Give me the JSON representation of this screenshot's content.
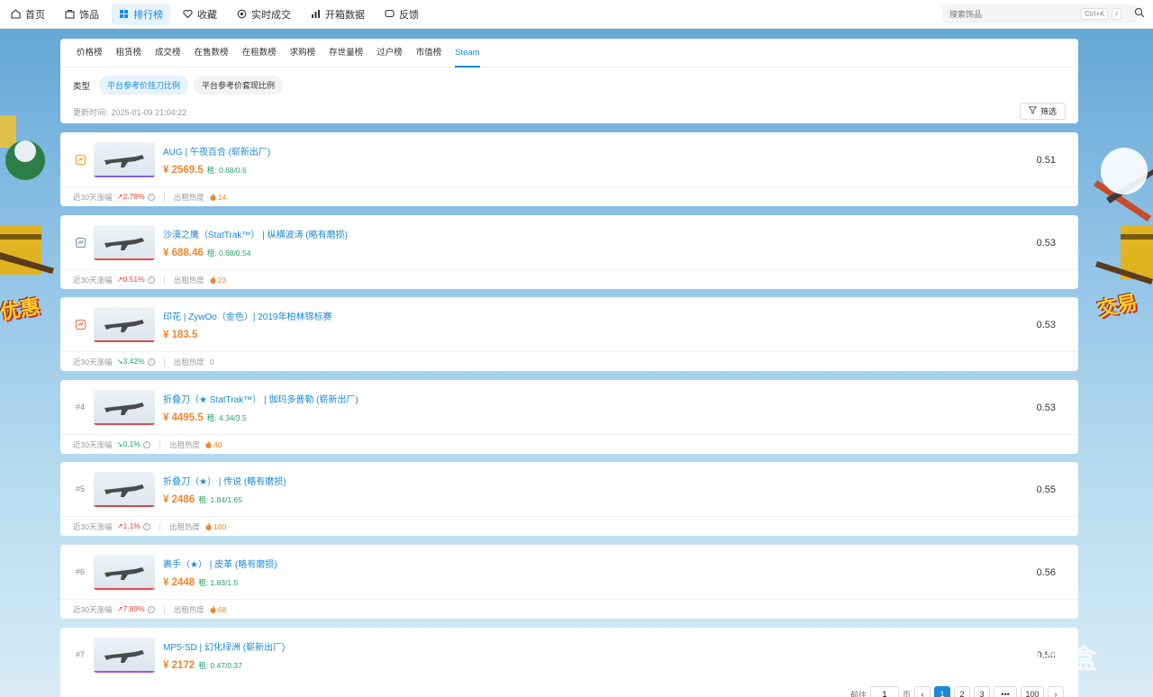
{
  "nav": {
    "items": [
      {
        "label": "首页",
        "icon": "home-icon"
      },
      {
        "label": "饰品",
        "icon": "bag-icon"
      },
      {
        "label": "排行榜",
        "icon": "grid-icon",
        "active": true
      },
      {
        "label": "收藏",
        "icon": "heart-icon"
      },
      {
        "label": "实时成交",
        "icon": "live-icon"
      },
      {
        "label": "开箱数据",
        "icon": "chart-icon"
      },
      {
        "label": "反馈",
        "icon": "chat-icon"
      }
    ],
    "search_placeholder": "搜索饰品",
    "shortcut": "Ctrl+K",
    "slash": "/"
  },
  "panel": {
    "tabs": [
      "价格榜",
      "租赁榜",
      "成交榜",
      "在售数榜",
      "在租数榜",
      "求购榜",
      "存世量榜",
      "过户榜",
      "市值榜",
      "Steam"
    ],
    "active_tab": "Steam",
    "type_label": "类型",
    "chips": [
      "平台参考价挂刀比例",
      "平台参考价套现比例"
    ],
    "update_label": "更新时间:",
    "update_time": "2025-01-09 21:04:22",
    "filter_label": "筛选"
  },
  "side": {
    "promo_left": "优惠",
    "promo_right": "交易"
  },
  "items": [
    {
      "rank": "",
      "medal": "gold",
      "name": "AUG | 午夜百合 (崭新出厂)",
      "price": "¥ 2569.5",
      "rent": "租: 0.68/0.6",
      "ratio": "0.51",
      "change_label": "近30天涨幅",
      "change": "↗2.78%",
      "dir": "up",
      "heat_label": "出租热度",
      "heat": "14",
      "bar": "#8d5bd6"
    },
    {
      "rank": "",
      "medal": "silver",
      "name": "沙漠之鹰（StatTrak™） | 纵横波涛 (略有磨损)",
      "price": "¥ 688.46",
      "rent": "租: 0.68/0.54",
      "ratio": "0.53",
      "change_label": "近30天涨幅",
      "change": "↗0.51%",
      "dir": "up",
      "heat_label": "出租热度",
      "heat": "23",
      "bar": "#e04a4a"
    },
    {
      "rank": "",
      "medal": "bronze",
      "name": "印花 | ZywOo（金色）| 2019年柏林锦标赛",
      "price": "¥ 183.5",
      "rent": "",
      "ratio": "0.53",
      "change_label": "近30天涨幅",
      "change": "↘3.42%",
      "dir": "down",
      "heat_label": "出租热度",
      "heat": "0",
      "bar": "#e04a4a"
    },
    {
      "rank": "#4",
      "medal": "",
      "name": "折叠刀（★ StatTrak™） | 伽玛多普勒 (崭新出厂)",
      "price": "¥ 4495.5",
      "rent": "租: 4.34/3.5",
      "ratio": "0.53",
      "change_label": "近30天涨幅",
      "change": "↘0.1%",
      "dir": "down",
      "heat_label": "出租热度",
      "heat": "40",
      "bar": "#e04a4a"
    },
    {
      "rank": "#5",
      "medal": "",
      "name": "折叠刀（★） | 传说 (略有磨损)",
      "price": "¥ 2486",
      "rent": "租: 1.84/1.65",
      "ratio": "0.55",
      "change_label": "近30天涨幅",
      "change": "↗1.1%",
      "dir": "up",
      "heat_label": "出租热度",
      "heat": "100",
      "bar": "#e04a4a"
    },
    {
      "rank": "#6",
      "medal": "",
      "name": "裹手（★） | 皮革 (略有磨损)",
      "price": "¥ 2448",
      "rent": "租: 1.83/1.5",
      "ratio": "0.56",
      "change_label": "近30天涨幅",
      "change": "↗7.89%",
      "dir": "up",
      "heat_label": "出租热度",
      "heat": "68",
      "bar": "#e04a4a"
    },
    {
      "rank": "#7",
      "medal": "",
      "name": "MP5-SD | 幻化绿洲 (崭新出厂)",
      "price": "¥ 2172",
      "rent": "租: 0.47/0.37",
      "ratio": "0.56",
      "change_label": "",
      "change": "",
      "dir": "up",
      "heat_label": "",
      "heat": "",
      "bar": "#b84ad6"
    }
  ],
  "pager": {
    "prefix": "前往",
    "goto_value": "1",
    "suffix": "页",
    "pages": [
      "1",
      "2",
      "3",
      "•••",
      "100"
    ],
    "current": "1"
  },
  "watermark": "小黑盒"
}
